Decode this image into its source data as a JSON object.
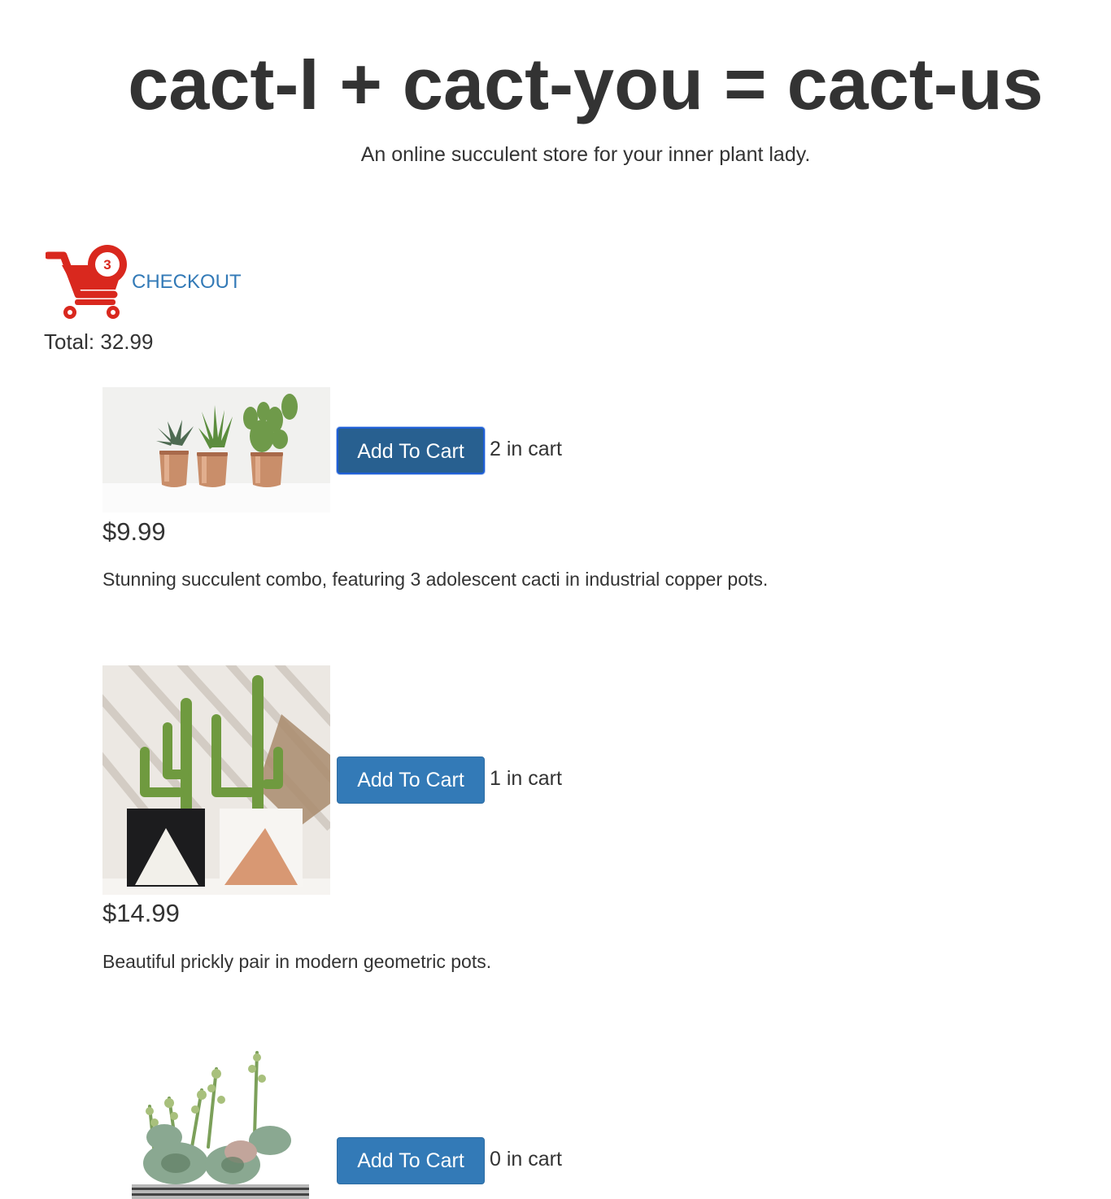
{
  "header": {
    "title": "cact-I + cact-you = cact-us",
    "tagline": "An online succulent store for your inner plant lady."
  },
  "cart": {
    "count": "3",
    "checkout_label": "CHECKOUT",
    "total_text": "Total: 32.99",
    "icon": "shopping-cart-icon",
    "accent_color": "#d9281e"
  },
  "products": [
    {
      "image": "three-cacti-copper-pots",
      "button_label": "Add To Cart",
      "in_cart": "2 in cart",
      "price": "$9.99",
      "description": "Stunning succulent combo, featuring 3 adolescent cacti in industrial copper pots."
    },
    {
      "image": "prickly-pair-geometric-pots",
      "button_label": "Add To Cart",
      "in_cart": "1 in cart",
      "price": "$14.99",
      "description": "Beautiful prickly pair in modern geometric pots."
    },
    {
      "image": "succulent-bowl",
      "button_label": "Add To Cart",
      "in_cart": "0 in cart"
    }
  ],
  "colors": {
    "button": "#337ab7",
    "button_active": "#286090",
    "link": "#337ab7",
    "text": "#333333"
  }
}
